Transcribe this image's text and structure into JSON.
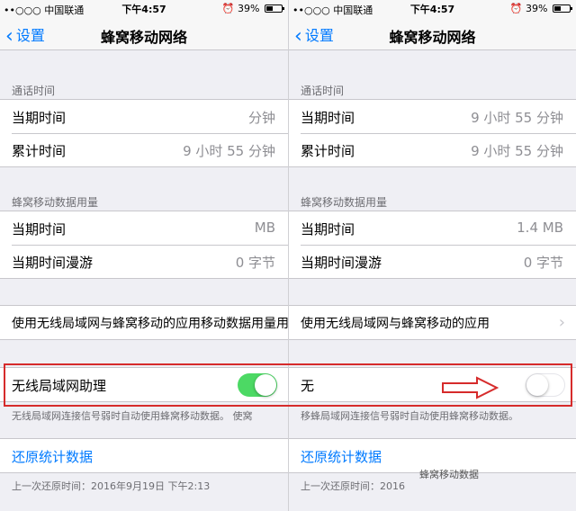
{
  "left_panel": {
    "status": {
      "carrier": "••○○○ 中国联通",
      "time": "下午4:57",
      "battery_pct": "39%"
    },
    "nav": {
      "back_label": "设置",
      "title": "蜂窝移动网络"
    },
    "call_time": {
      "header": "通话时间",
      "rows": [
        {
          "label": "当期时间",
          "value": "分钟"
        },
        {
          "label": "累计时间",
          "value": "9 小时 55 分钟"
        }
      ]
    },
    "data_usage": {
      "header": "蜂窝移动数据用量",
      "rows": [
        {
          "label": "当期时间",
          "value": "MB"
        },
        {
          "label": "当期时间漫游",
          "value": "0 字节"
        }
      ]
    },
    "apps_row": {
      "label": "使用无线局域网与蜂窝移动的应用移动数据用量用量"
    },
    "wifi_assist": {
      "label": "无线局域网助理",
      "state": "on",
      "footnote": "无线局域网连接信号弱时自动使用蜂窝移动数据。  使窝"
    },
    "reset": {
      "label": "还原统计数据",
      "footnote": "上一次还原时间：2016年9月19日 下午2:13"
    }
  },
  "right_panel": {
    "status": {
      "carrier": "••○○○ 中国联通",
      "time": "下午4:57",
      "battery_pct": "39%"
    },
    "nav": {
      "back_label": "设置",
      "title": "蜂窝移动网络"
    },
    "call_time": {
      "header": "通话时间",
      "rows": [
        {
          "label": "当期时间",
          "value": "9 小时 55 分钟"
        },
        {
          "label": "累计时间",
          "value": "9 小时 55 分钟"
        }
      ]
    },
    "data_usage": {
      "header": "蜂窝移动数据用量",
      "rows": [
        {
          "label": "当期时间",
          "value": "1.4 MB"
        },
        {
          "label": "当期时间漫游",
          "value": "0 字节"
        }
      ]
    },
    "apps_row": {
      "label": "使用无线局域网与蜂窝移动的应用"
    },
    "wifi_assist": {
      "label": "无",
      "state": "off",
      "footnote": "移蜂局域网连接信号弱时自动使用蜂窝移动数据。"
    },
    "reset": {
      "label": "还原统计数据",
      "footnote": "上一次还原时间：2016",
      "overlay": "蜂窝移动数据"
    }
  },
  "colors": {
    "accent": "#007aff",
    "toggle_on": "#4cd964",
    "annotation": "#d62b2b"
  }
}
